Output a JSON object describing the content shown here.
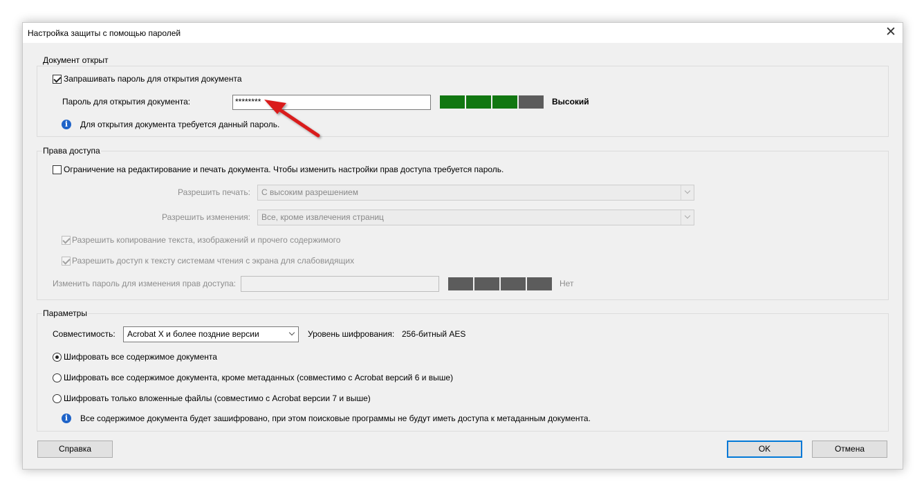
{
  "window": {
    "title": "Настройка защиты с помощью паролей",
    "close_glyph": "✕"
  },
  "open_section": {
    "legend": "Документ открыт",
    "require_password_label": "Запрашивать пароль для открытия документа",
    "require_password_checked": true,
    "password_label": "Пароль для открытия документа:",
    "password_value": "********",
    "strength_text": "Высокий",
    "strength_level": 3,
    "strength_colors": [
      "#117711",
      "#117711",
      "#117711",
      "#5c5c5c"
    ],
    "info_text": "Для открытия документа требуется данный пароль."
  },
  "permissions_section": {
    "legend": "Права доступа",
    "restrict_label": "Ограничение на редактирование и печать документа. Чтобы изменить настройки прав доступа требуется пароль.",
    "restrict_checked": false,
    "print_label": "Разрешить печать:",
    "print_value": "С высоким разрешением",
    "changes_label": "Разрешить изменения:",
    "changes_value": "Все, кроме извлечения страниц",
    "allow_copy_label": "Разрешить копирование текста, изображений и прочего содержимого",
    "allow_copy_checked": true,
    "allow_access_label": "Разрешить доступ к тексту системам чтения с экрана для слабовидящих",
    "allow_access_checked": true,
    "change_password_label": "Изменить пароль для изменения прав доступа:",
    "change_password_value": "",
    "strength_text": "Нет",
    "strength_colors": [
      "#5c5c5c",
      "#5c5c5c",
      "#5c5c5c",
      "#5c5c5c"
    ]
  },
  "params_section": {
    "legend": "Параметры",
    "compat_label": "Совместимость:",
    "compat_value": "Acrobat X и более поздние версии",
    "encryption_level_label": "Уровень шифрования:",
    "encryption_level_value": "256-битный AES",
    "options": [
      {
        "label": "Шифровать все содержимое документа",
        "selected": true
      },
      {
        "label": "Шифровать все содержимое документа, кроме метаданных (совместимо с Acrobat версий 6 и выше)",
        "selected": false
      },
      {
        "label": "Шифровать только вложенные файлы (совместимо с Acrobat версии 7 и выше)",
        "selected": false
      }
    ],
    "info_text": "Все содержимое документа будет зашифровано, при этом поисковые программы не будут иметь доступа к метаданным документа."
  },
  "buttons": {
    "help": "Справка",
    "ok": "OK",
    "cancel": "Отмена"
  },
  "annotation": {
    "arrow_color": "#d91c1c",
    "icon": "red-arrow-icon"
  },
  "info_glyph": "i",
  "colors": {
    "dialog_bg": "#f0f0f0",
    "accent": "#0078d7",
    "strength_green": "#117711",
    "strength_gray": "#5c5c5c"
  }
}
